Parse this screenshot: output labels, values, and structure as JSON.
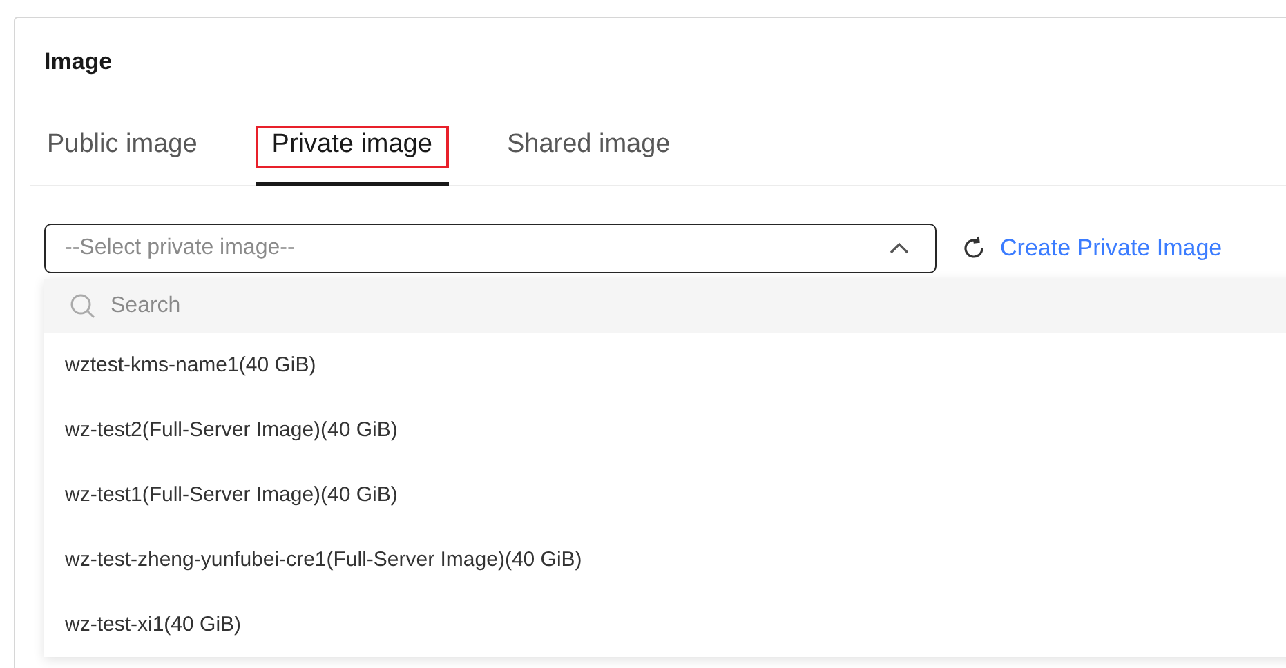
{
  "section": {
    "title": "Image"
  },
  "tabs": [
    {
      "label": "Public image",
      "selected": false,
      "highlighted": false
    },
    {
      "label": "Private image",
      "selected": true,
      "highlighted": true
    },
    {
      "label": "Shared image",
      "selected": false,
      "highlighted": false
    }
  ],
  "select": {
    "placeholder": "--Select private image--",
    "expanded": true
  },
  "create_link": "Create Private Image",
  "dropdown": {
    "search_placeholder": "Search",
    "options": [
      "wztest-kms-name1(40 GiB)",
      "wz-test2(Full-Server Image)(40 GiB)",
      "wz-test1(Full-Server Image)(40 GiB)",
      "wz-test-zheng-yunfubei-cre1(Full-Server Image)(40 GiB)",
      "wz-test-xi1(40 GiB)"
    ]
  }
}
